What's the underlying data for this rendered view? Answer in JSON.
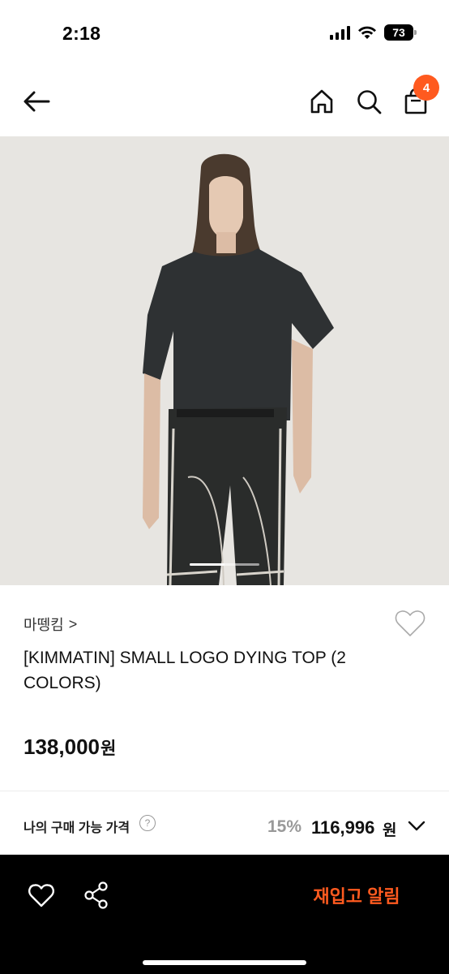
{
  "status_bar": {
    "time": "2:18",
    "battery": "73",
    "icons": [
      "signal-icon",
      "wifi-icon",
      "battery-icon"
    ]
  },
  "nav": {
    "icons": [
      "back-arrow-icon",
      "home-icon",
      "search-icon",
      "shopping-bag-icon"
    ],
    "cart_count": "4",
    "badge_color": "#ff5a1f"
  },
  "product": {
    "image_alt_icon": "product-photo",
    "brand": "마뗑킴",
    "brand_chevron": ">",
    "title": "[KIMMATIN] SMALL LOGO DYING TOP (2 COLORS)",
    "price": "138,000",
    "price_unit": "원"
  },
  "my_price": {
    "label": "나의 구매 가능 가격",
    "help": "?",
    "discount_rate": "15%",
    "discount_price": "116,996",
    "unit": "원"
  },
  "bottom_bar": {
    "restock_label": "재입고 알림",
    "accent_color": "#ff5a1f",
    "icons": [
      "heart-icon",
      "share-icon"
    ]
  }
}
